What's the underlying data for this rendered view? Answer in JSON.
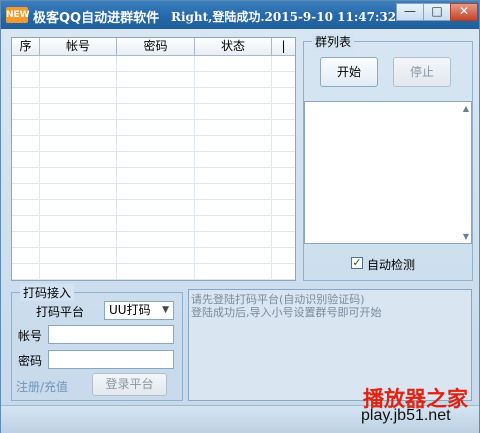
{
  "window": {
    "app_icon_text": "NEW",
    "title": "极客QQ自动进群软件",
    "status_text": "Right,登陆成功.2015-9-10 11:47:32",
    "min_label": "—",
    "max_label": "□",
    "close_label": "✕"
  },
  "grid": {
    "columns": [
      "序",
      "帐号",
      "密码",
      "状态",
      "|"
    ]
  },
  "group_list": {
    "title": "群列表",
    "start_label": "开始",
    "stop_label": "停止",
    "auto_detect_label": "自动检测",
    "auto_detect_checked": true
  },
  "captcha": {
    "title": "打码接入",
    "platform_label": "打码平台",
    "platform_value": "UU打码",
    "account_label": "帐号",
    "password_label": "密码",
    "register_link": "注册/充值",
    "login_label": "登录平台"
  },
  "log": {
    "lines": [
      "请先登陆打码平台(自动识别验证码)",
      "登陆成功后,导入小号设置群号即可开始"
    ]
  },
  "watermark": {
    "line1": "播放器之家",
    "line2": "play.jb51.net"
  }
}
